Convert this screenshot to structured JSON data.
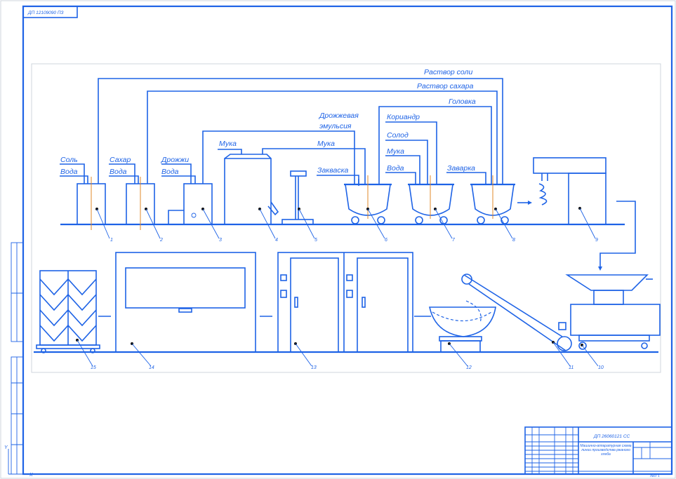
{
  "colors": {
    "line": "#1e63e6",
    "accent": "#e08a2a",
    "background": "#ffffff"
  },
  "stamp": {
    "corner_code": "ДП 12109090 ПЗ",
    "doc_code": "ДП 26060121 СС",
    "sheet": "Лист 1"
  },
  "title_block": {
    "title": "Машинно-аппаратурная схема линии производства ржаного хлеба"
  },
  "inputs": {
    "salt": "Соль",
    "water1": "Вода",
    "sugar": "Сахар",
    "water2": "Вода",
    "yeast": "Дрожжи",
    "water3": "Вода",
    "flour_top": "Мука",
    "flour_line": "Мука",
    "yeast_emulsion_1": "Дрожжевая",
    "yeast_emulsion_2": "эмульсия",
    "zakvaska": "Закваска",
    "coriander": "Кориандр",
    "malt": "Солод",
    "flour2": "Мука",
    "water4": "Вода",
    "zavarka": "Заварка",
    "salt_solution": "Раствор соли",
    "sugar_solution": "Раствор сахара",
    "golovka": "Головка"
  },
  "positions": [
    "1",
    "2",
    "3",
    "4",
    "5",
    "6",
    "7",
    "8",
    "9",
    "10",
    "11",
    "12",
    "13",
    "14",
    "15"
  ],
  "axis": {
    "y": "Y",
    "x": "X"
  }
}
